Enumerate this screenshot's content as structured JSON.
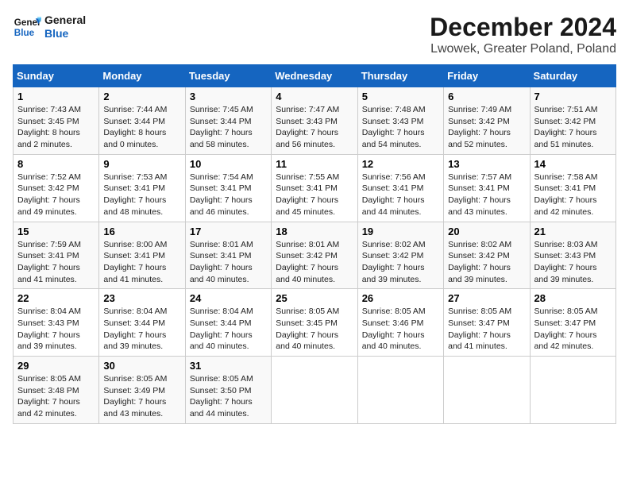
{
  "logo": {
    "line1": "General",
    "line2": "Blue"
  },
  "title": "December 2024",
  "subtitle": "Lwowek, Greater Poland, Poland",
  "days_of_week": [
    "Sunday",
    "Monday",
    "Tuesday",
    "Wednesday",
    "Thursday",
    "Friday",
    "Saturday"
  ],
  "weeks": [
    [
      {
        "num": "1",
        "rise": "7:43 AM",
        "set": "3:45 PM",
        "daylight": "8 hours and 2 minutes."
      },
      {
        "num": "2",
        "rise": "7:44 AM",
        "set": "3:44 PM",
        "daylight": "8 hours and 0 minutes."
      },
      {
        "num": "3",
        "rise": "7:45 AM",
        "set": "3:44 PM",
        "daylight": "7 hours and 58 minutes."
      },
      {
        "num": "4",
        "rise": "7:47 AM",
        "set": "3:43 PM",
        "daylight": "7 hours and 56 minutes."
      },
      {
        "num": "5",
        "rise": "7:48 AM",
        "set": "3:43 PM",
        "daylight": "7 hours and 54 minutes."
      },
      {
        "num": "6",
        "rise": "7:49 AM",
        "set": "3:42 PM",
        "daylight": "7 hours and 52 minutes."
      },
      {
        "num": "7",
        "rise": "7:51 AM",
        "set": "3:42 PM",
        "daylight": "7 hours and 51 minutes."
      }
    ],
    [
      {
        "num": "8",
        "rise": "7:52 AM",
        "set": "3:42 PM",
        "daylight": "7 hours and 49 minutes."
      },
      {
        "num": "9",
        "rise": "7:53 AM",
        "set": "3:41 PM",
        "daylight": "7 hours and 48 minutes."
      },
      {
        "num": "10",
        "rise": "7:54 AM",
        "set": "3:41 PM",
        "daylight": "7 hours and 46 minutes."
      },
      {
        "num": "11",
        "rise": "7:55 AM",
        "set": "3:41 PM",
        "daylight": "7 hours and 45 minutes."
      },
      {
        "num": "12",
        "rise": "7:56 AM",
        "set": "3:41 PM",
        "daylight": "7 hours and 44 minutes."
      },
      {
        "num": "13",
        "rise": "7:57 AM",
        "set": "3:41 PM",
        "daylight": "7 hours and 43 minutes."
      },
      {
        "num": "14",
        "rise": "7:58 AM",
        "set": "3:41 PM",
        "daylight": "7 hours and 42 minutes."
      }
    ],
    [
      {
        "num": "15",
        "rise": "7:59 AM",
        "set": "3:41 PM",
        "daylight": "7 hours and 41 minutes."
      },
      {
        "num": "16",
        "rise": "8:00 AM",
        "set": "3:41 PM",
        "daylight": "7 hours and 41 minutes."
      },
      {
        "num": "17",
        "rise": "8:01 AM",
        "set": "3:41 PM",
        "daylight": "7 hours and 40 minutes."
      },
      {
        "num": "18",
        "rise": "8:01 AM",
        "set": "3:42 PM",
        "daylight": "7 hours and 40 minutes."
      },
      {
        "num": "19",
        "rise": "8:02 AM",
        "set": "3:42 PM",
        "daylight": "7 hours and 39 minutes."
      },
      {
        "num": "20",
        "rise": "8:02 AM",
        "set": "3:42 PM",
        "daylight": "7 hours and 39 minutes."
      },
      {
        "num": "21",
        "rise": "8:03 AM",
        "set": "3:43 PM",
        "daylight": "7 hours and 39 minutes."
      }
    ],
    [
      {
        "num": "22",
        "rise": "8:04 AM",
        "set": "3:43 PM",
        "daylight": "7 hours and 39 minutes."
      },
      {
        "num": "23",
        "rise": "8:04 AM",
        "set": "3:44 PM",
        "daylight": "7 hours and 39 minutes."
      },
      {
        "num": "24",
        "rise": "8:04 AM",
        "set": "3:44 PM",
        "daylight": "7 hours and 40 minutes."
      },
      {
        "num": "25",
        "rise": "8:05 AM",
        "set": "3:45 PM",
        "daylight": "7 hours and 40 minutes."
      },
      {
        "num": "26",
        "rise": "8:05 AM",
        "set": "3:46 PM",
        "daylight": "7 hours and 40 minutes."
      },
      {
        "num": "27",
        "rise": "8:05 AM",
        "set": "3:47 PM",
        "daylight": "7 hours and 41 minutes."
      },
      {
        "num": "28",
        "rise": "8:05 AM",
        "set": "3:47 PM",
        "daylight": "7 hours and 42 minutes."
      }
    ],
    [
      {
        "num": "29",
        "rise": "8:05 AM",
        "set": "3:48 PM",
        "daylight": "7 hours and 42 minutes."
      },
      {
        "num": "30",
        "rise": "8:05 AM",
        "set": "3:49 PM",
        "daylight": "7 hours and 43 minutes."
      },
      {
        "num": "31",
        "rise": "8:05 AM",
        "set": "3:50 PM",
        "daylight": "7 hours and 44 minutes."
      },
      null,
      null,
      null,
      null
    ]
  ],
  "labels": {
    "sunrise": "Sunrise:",
    "sunset": "Sunset:",
    "daylight": "Daylight:"
  }
}
